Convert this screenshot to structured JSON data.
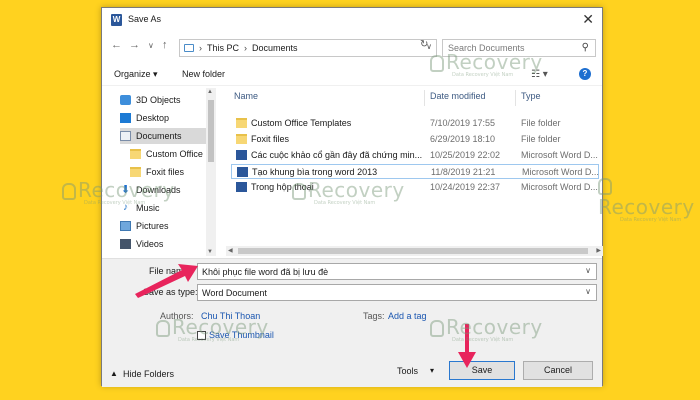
{
  "window": {
    "title": "Save As",
    "app_icon": "word-app-icon"
  },
  "nav": {
    "breadcrumb": [
      "This PC",
      "Documents"
    ],
    "search_placeholder": "Search Documents"
  },
  "toolbar": {
    "organize": "Organize ▾",
    "new_folder": "New folder",
    "help": "?"
  },
  "sidebar": {
    "items": [
      {
        "label": "3D Objects",
        "icon": "3d-objects-icon"
      },
      {
        "label": "Desktop",
        "icon": "desktop-icon"
      },
      {
        "label": "Documents",
        "icon": "documents-icon",
        "selected": true
      },
      {
        "label": "Custom Office",
        "icon": "folder-icon"
      },
      {
        "label": "Foxit files",
        "icon": "folder-icon"
      },
      {
        "label": "Downloads",
        "icon": "downloads-icon"
      },
      {
        "label": "Music",
        "icon": "music-icon"
      },
      {
        "label": "Pictures",
        "icon": "pictures-icon"
      },
      {
        "label": "Videos",
        "icon": "videos-icon"
      }
    ]
  },
  "files": {
    "columns": [
      "Name",
      "Date modified",
      "Type"
    ],
    "rows": [
      {
        "name": "Custom Office Templates",
        "date": "7/10/2019 17:55",
        "type": "File folder",
        "icon": "folder-icon"
      },
      {
        "name": "Foxit files",
        "date": "6/29/2019 18:10",
        "type": "File folder",
        "icon": "folder-icon"
      },
      {
        "name": "Các cuộc khảo cổ gần đây đã chứng min...",
        "date": "10/25/2019 22:02",
        "type": "Microsoft Word D...",
        "icon": "word-doc-icon"
      },
      {
        "name": "Tạo khung bìa trong word 2013",
        "date": "11/8/2019 21:21",
        "type": "Microsoft Word D...",
        "icon": "word-doc-icon",
        "selected": true
      },
      {
        "name": "Trong hộp thoại",
        "date": "10/24/2019 22:37",
        "type": "Microsoft Word D...",
        "icon": "word-doc-icon"
      }
    ]
  },
  "form": {
    "file_name_label": "File name:",
    "file_name_value": "Khôi phục file word đã bị lưu đè",
    "save_type_label": "Save as type:",
    "save_type_value": "Word Document",
    "authors_label": "Authors:",
    "authors_value": "Chu Thi Thoan",
    "tags_label": "Tags:",
    "tags_value": "Add a tag",
    "thumbnail_label": "Save Thumbnail"
  },
  "footer": {
    "hide_folders": "Hide Folders",
    "tools": "Tools",
    "save": "Save",
    "cancel": "Cancel"
  },
  "watermark": {
    "brand": "Recovery",
    "tagline": "Data Recovery Việt Nam"
  },
  "colors": {
    "background": "#ffd21f",
    "annotation_arrow": "#e8245c",
    "link": "#1a56b0",
    "primary_border": "#2a78cf"
  }
}
